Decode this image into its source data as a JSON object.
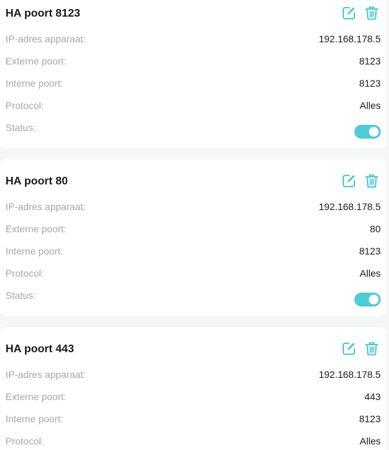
{
  "colors": {
    "accent": "#4ecbd6",
    "label": "#a3a7ad",
    "value": "#1a1a1a",
    "card_background": "#ffffff",
    "page_background": "#f5f6f8"
  },
  "icons": {
    "edit": "edit-icon",
    "delete": "trash-icon"
  },
  "rules": [
    {
      "name": "HA poort 8123",
      "fields": [
        {
          "label": "IP-adres apparaat:",
          "value": "192.168.178.5"
        },
        {
          "label": "Externe poort:",
          "value": "8123"
        },
        {
          "label": "Interne poort:",
          "value": "8123"
        },
        {
          "label": "Protocol:",
          "value": "Alles"
        }
      ],
      "status_label": "Status:",
      "status_enabled": true
    },
    {
      "name": "HA poort 80",
      "fields": [
        {
          "label": "IP-adres apparaat:",
          "value": "192.168.178.5"
        },
        {
          "label": "Externe poort:",
          "value": "80"
        },
        {
          "label": "Interne poort:",
          "value": "8123"
        },
        {
          "label": "Protocol:",
          "value": "Alles"
        }
      ],
      "status_label": "Status:",
      "status_enabled": true
    },
    {
      "name": "HA poort 443",
      "fields": [
        {
          "label": "IP-adres apparaat:",
          "value": "192.168.178.5"
        },
        {
          "label": "Externe poort:",
          "value": "443"
        },
        {
          "label": "Interne poort:",
          "value": "8123"
        },
        {
          "label": "Protocol:",
          "value": "Alles"
        }
      ]
    }
  ]
}
